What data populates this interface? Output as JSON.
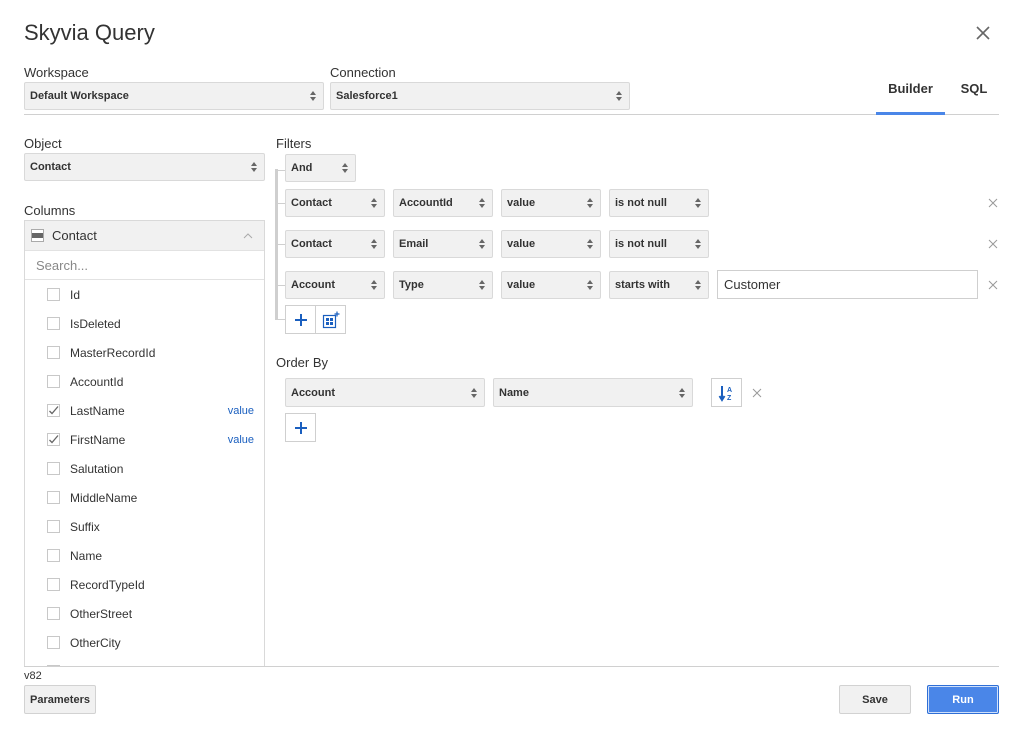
{
  "dialog": {
    "title": "Skyvia Query",
    "close_icon": "close-icon"
  },
  "workspace": {
    "label": "Workspace",
    "value": "Default Workspace"
  },
  "connection": {
    "label": "Connection",
    "value": "Salesforce1"
  },
  "tabs": [
    {
      "label": "Builder",
      "active": true
    },
    {
      "label": "SQL",
      "active": false
    }
  ],
  "object": {
    "label": "Object",
    "value": "Contact"
  },
  "columns": {
    "label": "Columns",
    "group": "Contact",
    "search_placeholder": "Search...",
    "items": [
      {
        "name": "Id",
        "checked": false,
        "tag": ""
      },
      {
        "name": "IsDeleted",
        "checked": false,
        "tag": ""
      },
      {
        "name": "MasterRecordId",
        "checked": false,
        "tag": ""
      },
      {
        "name": "AccountId",
        "checked": false,
        "tag": ""
      },
      {
        "name": "LastName",
        "checked": true,
        "tag": "value"
      },
      {
        "name": "FirstName",
        "checked": true,
        "tag": "value"
      },
      {
        "name": "Salutation",
        "checked": false,
        "tag": ""
      },
      {
        "name": "MiddleName",
        "checked": false,
        "tag": ""
      },
      {
        "name": "Suffix",
        "checked": false,
        "tag": ""
      },
      {
        "name": "Name",
        "checked": false,
        "tag": ""
      },
      {
        "name": "RecordTypeId",
        "checked": false,
        "tag": ""
      },
      {
        "name": "OtherStreet",
        "checked": false,
        "tag": ""
      },
      {
        "name": "OtherCity",
        "checked": false,
        "tag": ""
      }
    ]
  },
  "filters": {
    "label": "Filters",
    "logic": "And",
    "rows": [
      {
        "object": "Contact",
        "field": "AccountId",
        "kind": "value",
        "operator": "is not null",
        "value": null
      },
      {
        "object": "Contact",
        "field": "Email",
        "kind": "value",
        "operator": "is not null",
        "value": null
      },
      {
        "object": "Account",
        "field": "Type",
        "kind": "value",
        "operator": "starts with",
        "value": "Customer"
      }
    ]
  },
  "order_by": {
    "label": "Order By",
    "rows": [
      {
        "object": "Account",
        "field": "Name",
        "direction": "ascending"
      }
    ]
  },
  "footer": {
    "version": "v82",
    "parameters_label": "Parameters",
    "save_label": "Save",
    "run_label": "Run"
  },
  "colors": {
    "accent": "#4a86e8",
    "link": "#1a5fbf",
    "icon_blue": "#1a5fbf"
  }
}
